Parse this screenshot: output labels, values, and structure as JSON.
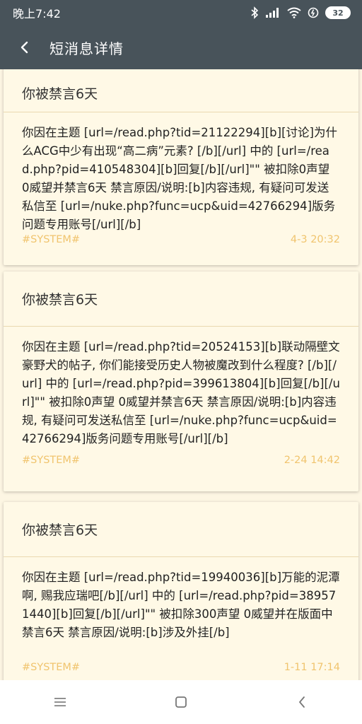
{
  "status": {
    "time": "晚上7:42",
    "battery": "32"
  },
  "appbar": {
    "title": "短消息详情"
  },
  "messages": [
    {
      "title": "你被禁言6天",
      "body": "你因在主题 [url=/read.php?tid=21122294][b][讨论]为什么ACG中少有出现“高二病”元素? [/b][/url] 中的 [url=/read.php?pid=410548304][b]回复[/b][/url]\"\" 被扣除0声望 0威望并禁言6天 禁言原因/说明:[b]内容违规, 有疑问可发送私信至 [url=/nuke.php?func=ucp&uid=42766294]版务问题专用账号[/url][/b]",
      "sender": "#SYSTEM#",
      "time": "4-3 20:32"
    },
    {
      "title": "你被禁言6天",
      "body": "你因在主题 [url=/read.php?tid=20524153][b]联动隔壁文豪野犬的帖子, 你们能接受历史人物被魔改到什么程度? [/b][/url] 中的 [url=/read.php?pid=399613804][b]回复[/b][/url]\"\" 被扣除0声望 0威望并禁言6天 禁言原因/说明:[b]内容违规, 有疑问可发送私信至 [url=/nuke.php?func=ucp&uid=42766294]版务问题专用账号[/url][/b]",
      "sender": "#SYSTEM#",
      "time": "2-24 14:42"
    },
    {
      "title": "你被禁言6天",
      "body": "你因在主题 [url=/read.php?tid=19940036][b]万能的泥潭啊, 赐我应瑞吧[/b][/url] 中的 [url=/read.php?pid=389571440][b]回复[/b][/url]\"\" 被扣除300声望 0威望并在版面中禁言6天 禁言原因/说明:[b]涉及外挂[/b]",
      "sender": "#SYSTEM#",
      "time": "1-11 17:14"
    }
  ],
  "colors": {
    "appbar": "#48535a",
    "background": "#fdf6e3",
    "card": "#fff9e6",
    "footer_text": "#f0c46e"
  },
  "icons": {
    "back": "back-arrow-icon",
    "bluetooth": "bluetooth-icon",
    "signal": "signal-icon",
    "wifi": "wifi-icon",
    "alarm": "alarm-icon",
    "nav_menu": "menu-icon",
    "nav_home": "home-icon",
    "nav_back": "back-icon"
  }
}
